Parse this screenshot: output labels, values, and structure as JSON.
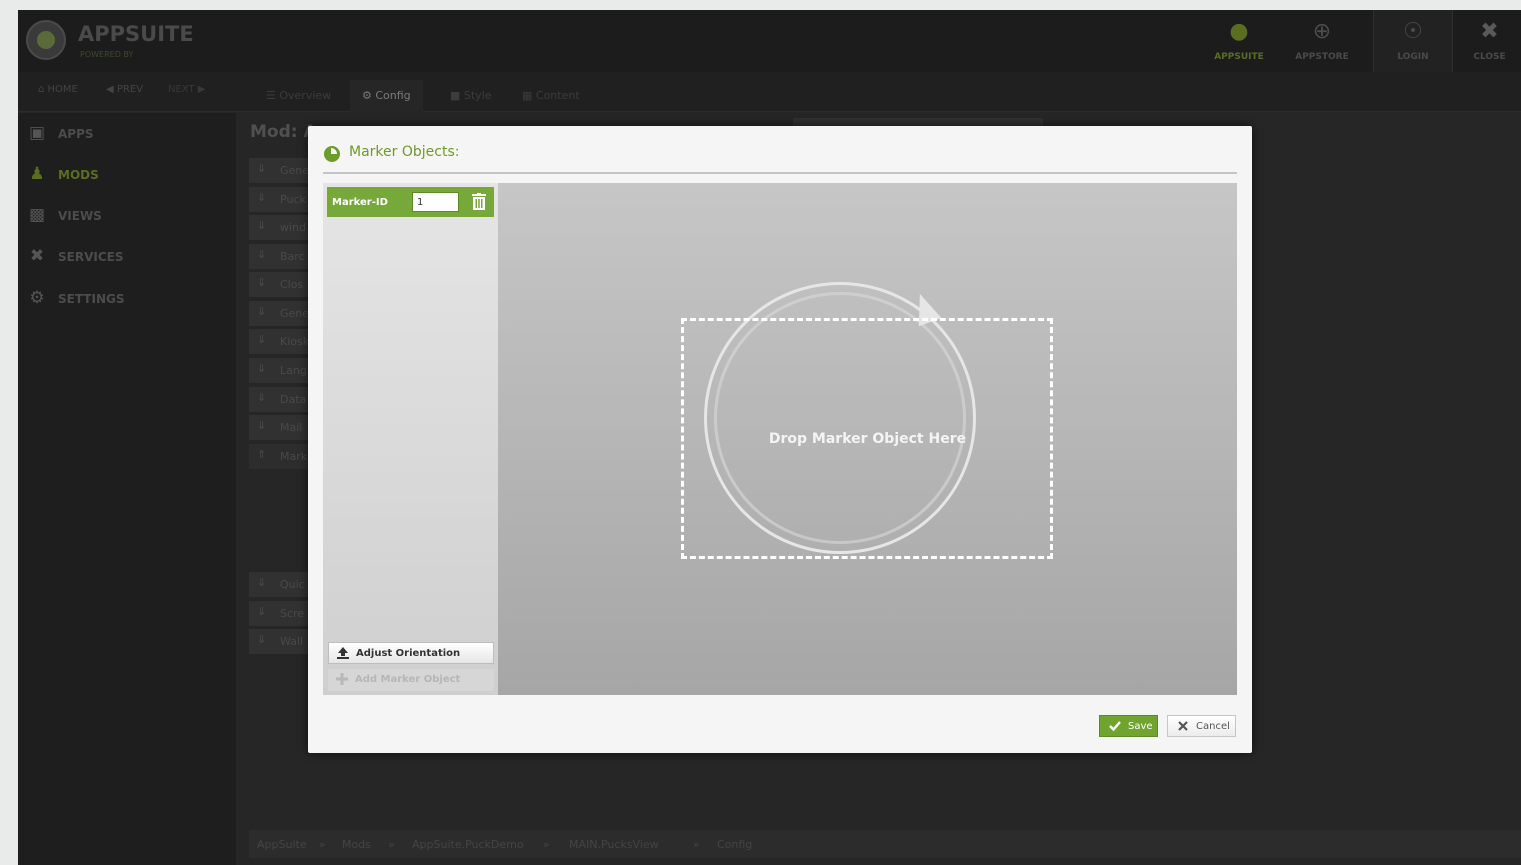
{
  "header": {
    "brand_title": "APPSUITE",
    "brand_subtitle": "POWERED BY",
    "buttons": [
      {
        "label": "APPSUITE",
        "icon": "appsuite-icon"
      },
      {
        "label": "APPSTORE",
        "icon": "appstore-icon"
      },
      {
        "label": "LOGIN",
        "icon": "login-icon"
      },
      {
        "label": "CLOSE",
        "icon": "close-icon"
      }
    ]
  },
  "nav": {
    "home": "HOME",
    "prev": "PREV",
    "next": "NEXT",
    "tabs": [
      {
        "label": "Overview",
        "active": false
      },
      {
        "label": "Config",
        "active": true
      },
      {
        "label": "Style",
        "active": false
      },
      {
        "label": "Content",
        "active": false
      }
    ]
  },
  "sidebar": {
    "items": [
      {
        "label": "APPS",
        "icon": "apps-icon"
      },
      {
        "label": "MODS",
        "icon": "mods-icon",
        "active": true
      },
      {
        "label": "VIEWS",
        "icon": "views-icon"
      },
      {
        "label": "SERVICES",
        "icon": "services-icon"
      },
      {
        "label": "SETTINGS",
        "icon": "settings-icon"
      }
    ]
  },
  "main": {
    "title": "Mod: A",
    "accordion": [
      "Gene",
      "Puck",
      "wind",
      "Barc",
      "Clos",
      "Gene",
      "Kiosk",
      "Lang",
      "Data",
      "Mail",
      "Mark"
    ],
    "accordion_lower": [
      "Quic",
      "Scre",
      "Wall"
    ],
    "breadcrumb": [
      "AppSuite",
      "Mods",
      "AppSuite.PuckDemo",
      "MAIN.PucksView",
      "Config"
    ]
  },
  "modal": {
    "title": "Marker Objects:",
    "marker_label": "Marker-ID",
    "marker_value": "1",
    "drop_text": "Drop Marker Object Here",
    "adjust_label": "Adjust Orientation",
    "add_label": "Add Marker Object",
    "save_label": "Save",
    "cancel_label": "Cancel"
  },
  "colors": {
    "accent": "#77a83a",
    "background": "#262626",
    "modal": "#f5f5f5"
  }
}
